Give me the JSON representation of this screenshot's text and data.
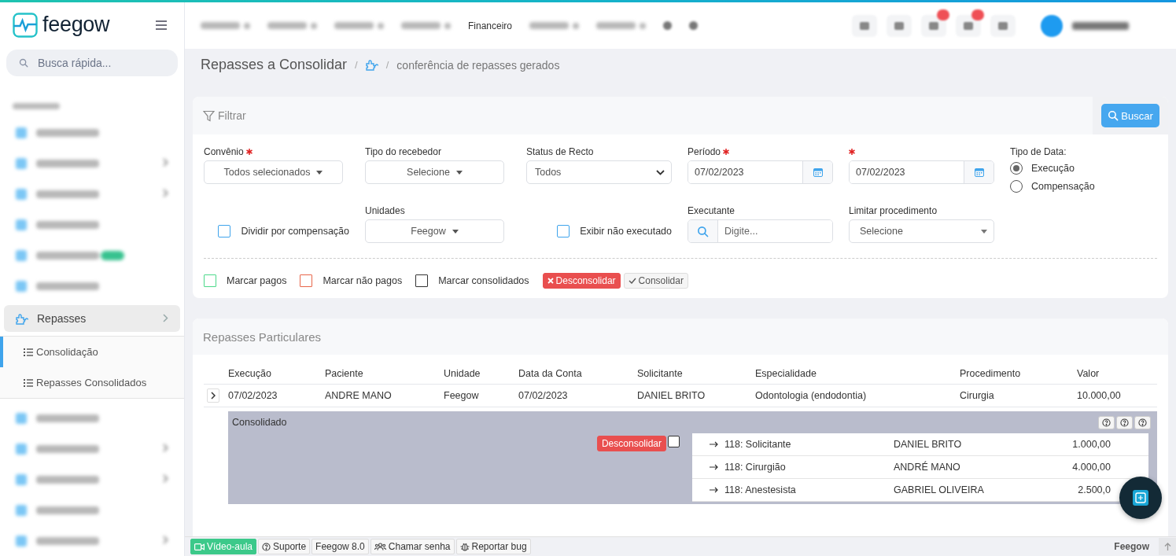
{
  "header": {
    "logo": "feegow",
    "nav": [
      {
        "kind": "blurred"
      },
      {
        "kind": "blurred"
      },
      {
        "kind": "blurred"
      },
      {
        "kind": "blurred"
      },
      {
        "kind": "link",
        "label": "Financeiro"
      },
      {
        "kind": "blurred"
      },
      {
        "kind": "blurred"
      },
      {
        "kind": "dot"
      },
      {
        "kind": "dot"
      }
    ],
    "tools": [
      {
        "badge": false
      },
      {
        "badge": false
      },
      {
        "badge": true
      },
      {
        "badge": true
      },
      {
        "badge": false
      }
    ]
  },
  "sidebar": {
    "search_placeholder": "Busca rápida...",
    "items": [
      {
        "kind": "heading"
      },
      {
        "kind": "blurred",
        "chevron": false,
        "badge": false
      },
      {
        "kind": "blurred",
        "chevron": true,
        "badge": false
      },
      {
        "kind": "blurred",
        "chevron": true,
        "badge": false
      },
      {
        "kind": "blurred",
        "chevron": false,
        "badge": false
      },
      {
        "kind": "blurred",
        "chevron": false,
        "badge": true
      },
      {
        "kind": "blurred",
        "chevron": false,
        "badge": false
      },
      {
        "kind": "link",
        "label": "Repasses",
        "chevron": true,
        "expanded": true,
        "children": [
          {
            "label": "Consolidação",
            "selected": true
          },
          {
            "label": "Repasses Consolidados",
            "selected": false
          }
        ]
      },
      {
        "kind": "blurred",
        "chevron": false,
        "badge": false
      },
      {
        "kind": "blurred",
        "chevron": true,
        "badge": false
      },
      {
        "kind": "blurred",
        "chevron": true,
        "badge": false
      },
      {
        "kind": "blurred",
        "chevron": false,
        "badge": false
      },
      {
        "kind": "blurred",
        "chevron": true,
        "badge": false
      }
    ]
  },
  "page": {
    "title": "Repasses a Consolidar",
    "separator": "/",
    "breadcrumb": "conferência de repasses gerados"
  },
  "filters": {
    "title": "Filtrar",
    "search_button": "Buscar",
    "fields": [
      {
        "kind": "dropdown",
        "label": "Convênio",
        "required": true,
        "value": "Todos selecionados"
      },
      {
        "kind": "dropdown",
        "label": "Tipo do recebedor",
        "required": false,
        "value": "Selecione"
      },
      {
        "kind": "select",
        "label": "Status de Recto",
        "required": false,
        "value": "Todos"
      },
      {
        "kind": "date",
        "label": "Período",
        "required": true,
        "value": "07/02/2023"
      },
      {
        "kind": "date",
        "required": true,
        "value": "07/02/2023"
      },
      {
        "kind": "radio",
        "label": "Tipo de Data:",
        "options": [
          {
            "label": "Execução",
            "selected": true
          },
          {
            "label": "Compensação",
            "selected": false
          }
        ]
      },
      {
        "kind": "checkbox",
        "label": "Dividir por compensação",
        "checked": false
      },
      {
        "kind": "dropdown",
        "label": "Unidades",
        "required": false,
        "value": "Feegow"
      },
      {
        "kind": "checkbox",
        "label": "Exibir não executado",
        "checked": false
      },
      {
        "kind": "search",
        "label": "Executante",
        "required": false,
        "placeholder": "Digite..."
      },
      {
        "kind": "combo",
        "label": "Limitar procedimento",
        "required": false,
        "value": "Selecione"
      }
    ],
    "marks": [
      {
        "label": "Marcar pagos",
        "color": "#4cd98a"
      },
      {
        "label": "Marcar não pagos",
        "color": "#e8664a"
      },
      {
        "label": "Marcar consolidados",
        "color": "#333333"
      }
    ],
    "actions": [
      {
        "kind": "danger",
        "label": "Desconsolidar"
      },
      {
        "kind": "default",
        "label": "Consolidar"
      }
    ]
  },
  "repasses": {
    "title": "Repasses Particulares",
    "columns": [
      "Execução",
      "Paciente",
      "Unidade",
      "Data da Conta",
      "Solicitante",
      "Especialidade",
      "Procedimento",
      "Valor"
    ],
    "rows": [
      {
        "expanded": true,
        "cells": [
          "07/02/2023",
          "ANDRE MANO",
          "Feegow",
          "07/02/2023",
          "DANIEL BRITO",
          "Odontologia (endodontia)",
          "Cirurgia",
          "10.000,00"
        ],
        "detail": {
          "title": "Consolidado",
          "action": "Desconsolidar",
          "checked": false,
          "items": [
            {
              "role": "118: Solicitante",
              "name": "DANIEL BRITO",
              "value": "1.000,00"
            },
            {
              "role": "118: Cirurgião",
              "name": "ANDRÉ MANO",
              "value": "4.000,00"
            },
            {
              "role": "118: Anestesista",
              "name": "GABRIEL OLIVEIRA",
              "value": "2.500,0"
            }
          ]
        }
      }
    ]
  },
  "footer": {
    "links": [
      {
        "kind": "video",
        "label": "Vídeo-aula"
      },
      {
        "kind": "help",
        "label": "Suporte"
      },
      {
        "kind": "plain",
        "label": "Feegow 8.0"
      },
      {
        "kind": "users",
        "label": "Chamar senha"
      },
      {
        "kind": "bug",
        "label": "Reportar bug"
      }
    ],
    "brand": "Feegow"
  }
}
